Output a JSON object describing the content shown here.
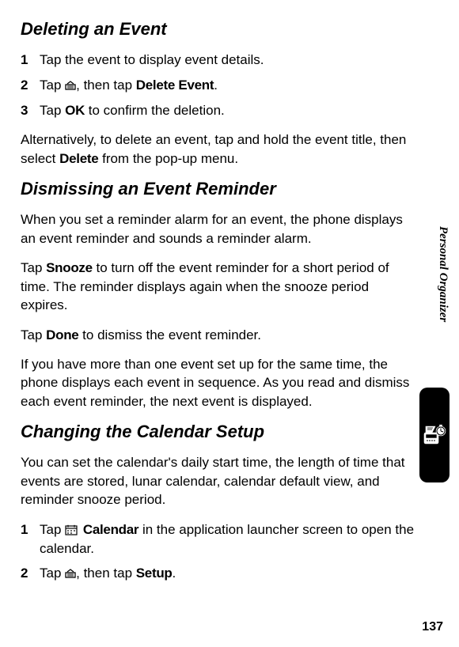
{
  "page_number": "137",
  "side_label": "Personal Organizer",
  "sections": {
    "deleting": {
      "heading": "Deleting an Event",
      "step1_num": "1",
      "step1_txt": "Tap the event to display event details.",
      "step2_num": "2",
      "step2_a": "Tap ",
      "step2_b": ", then tap ",
      "step2_cmd": "Delete Event",
      "step2_end": ".",
      "step3_num": "3",
      "step3_a": "Tap ",
      "step3_cmd": "OK",
      "step3_b": " to confirm the deletion.",
      "alt_a": "Alternatively, to delete an event, tap and hold the event title, then select ",
      "alt_cmd": "Delete",
      "alt_b": " from the pop-up menu."
    },
    "dismissing": {
      "heading": "Dismissing an Event Reminder",
      "p1": "When you set a reminder alarm for an event, the phone displays an event reminder and sounds a reminder alarm.",
      "p2_a": "Tap ",
      "p2_cmd": "Snooze",
      "p2_b": " to turn off the event reminder for a short period of time. The reminder displays again when the snooze period expires.",
      "p3_a": "Tap ",
      "p3_cmd": "Done",
      "p3_b": " to dismiss the event reminder.",
      "p4": "If you have more than one event set up for the same time, the phone displays each event in sequence. As you read and dismiss each event reminder, the next event is displayed."
    },
    "changing": {
      "heading": "Changing the Calendar Setup",
      "p1": "You can set the calendar's daily start time, the length of time that events are stored, lunar calendar, calendar default view, and reminder snooze period.",
      "step1_num": "1",
      "step1_a": "Tap ",
      "step1_cmd": "Calendar",
      "step1_b": " in the application launcher screen to open the calendar.",
      "step2_num": "2",
      "step2_a": "Tap ",
      "step2_b": ", then tap ",
      "step2_cmd": "Setup",
      "step2_end": "."
    }
  }
}
